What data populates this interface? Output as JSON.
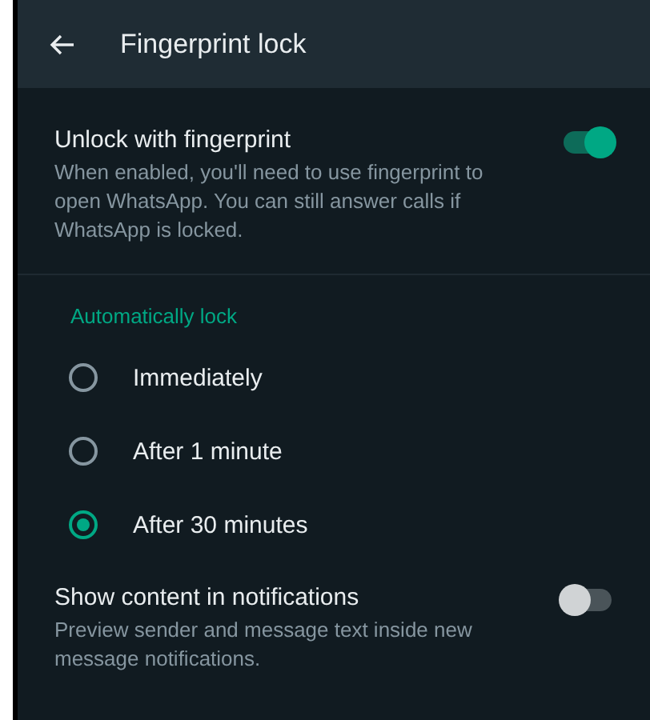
{
  "header": {
    "title": "Fingerprint lock"
  },
  "unlock": {
    "title": "Unlock with fingerprint",
    "description": "When enabled, you'll need to use fingerprint to open WhatsApp. You can still answer calls if WhatsApp is locked.",
    "on": true
  },
  "auto_lock": {
    "heading": "Automatically lock",
    "options": [
      {
        "label": "Immediately",
        "selected": false
      },
      {
        "label": "After 1 minute",
        "selected": false
      },
      {
        "label": "After 30 minutes",
        "selected": true
      }
    ]
  },
  "notifications": {
    "title": "Show content in notifications",
    "description": "Preview sender and message text inside new message notifications.",
    "on": false
  }
}
